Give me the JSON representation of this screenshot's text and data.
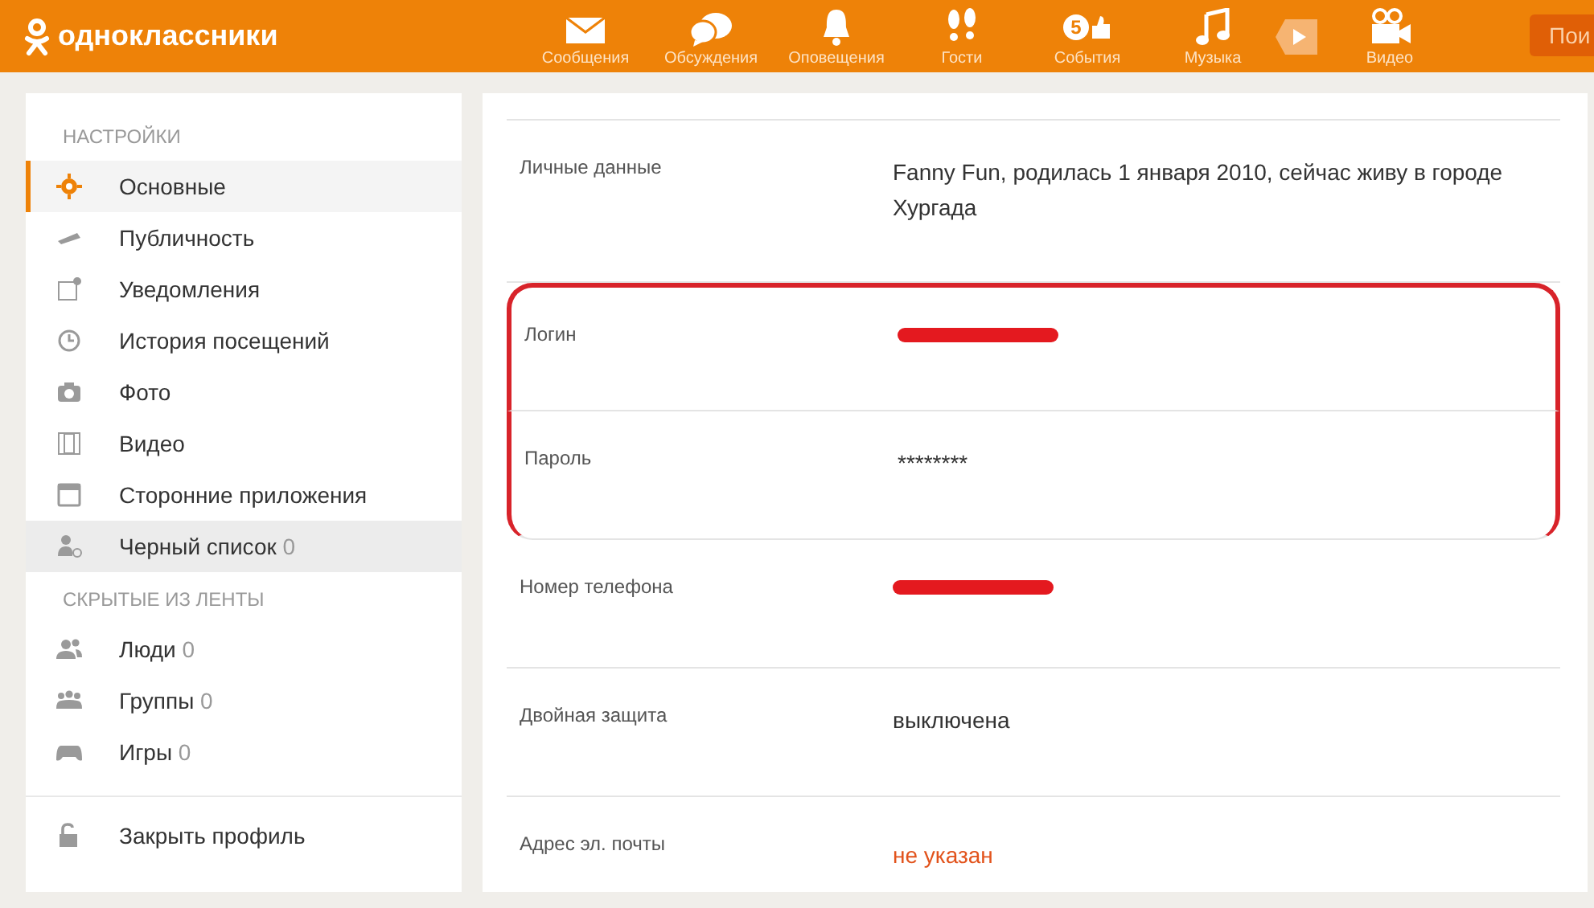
{
  "header": {
    "logo": "одноклассники",
    "nav": [
      {
        "label": "Сообщения"
      },
      {
        "label": "Обсуждения"
      },
      {
        "label": "Оповещения"
      },
      {
        "label": "Гости"
      },
      {
        "label": "События",
        "badge": "5"
      },
      {
        "label": "Музыка"
      },
      {
        "label": "Видео"
      }
    ],
    "search_button": "Пои"
  },
  "sidebar": {
    "sections": [
      {
        "title": "НАСТРОЙКИ",
        "items": [
          {
            "label": "Основные",
            "selected": true,
            "hovered": false
          },
          {
            "label": "Публичность",
            "selected": false,
            "hovered": false
          },
          {
            "label": "Уведомления",
            "selected": false,
            "hovered": false
          },
          {
            "label": "История посещений",
            "selected": false,
            "hovered": false
          },
          {
            "label": "Фото",
            "selected": false,
            "hovered": false
          },
          {
            "label": "Видео",
            "selected": false,
            "hovered": false
          },
          {
            "label": "Сторонние приложения",
            "selected": false,
            "hovered": false
          },
          {
            "label": "Черный список",
            "count": "0",
            "selected": false,
            "hovered": true
          }
        ]
      },
      {
        "title": "СКРЫТЫЕ ИЗ ЛЕНТЫ",
        "items": [
          {
            "label": "Люди",
            "count": "0",
            "selected": false,
            "hovered": false
          },
          {
            "label": "Группы",
            "count": "0",
            "selected": false,
            "hovered": false
          },
          {
            "label": "Игры",
            "count": "0",
            "selected": false,
            "hovered": false
          }
        ]
      }
    ],
    "footer_item": {
      "label": "Закрыть профиль"
    }
  },
  "settings": [
    {
      "label": "Личные данные",
      "kind": "text",
      "value": "Fanny Fun, родилась 1 января 2010, сейчас живу в городе Хургада",
      "highlighted": false
    },
    {
      "label": "Логин",
      "kind": "redacted",
      "highlighted": true
    },
    {
      "label": "Пароль",
      "kind": "text",
      "value": "********",
      "highlighted": true
    },
    {
      "label": "Номер телефона",
      "kind": "redacted",
      "highlighted": false
    },
    {
      "label": "Двойная защита",
      "kind": "text",
      "value": "выключена",
      "highlighted": false
    },
    {
      "label": "Адрес эл. почты",
      "kind": "missing",
      "value": "не указан",
      "highlighted": false
    }
  ]
}
